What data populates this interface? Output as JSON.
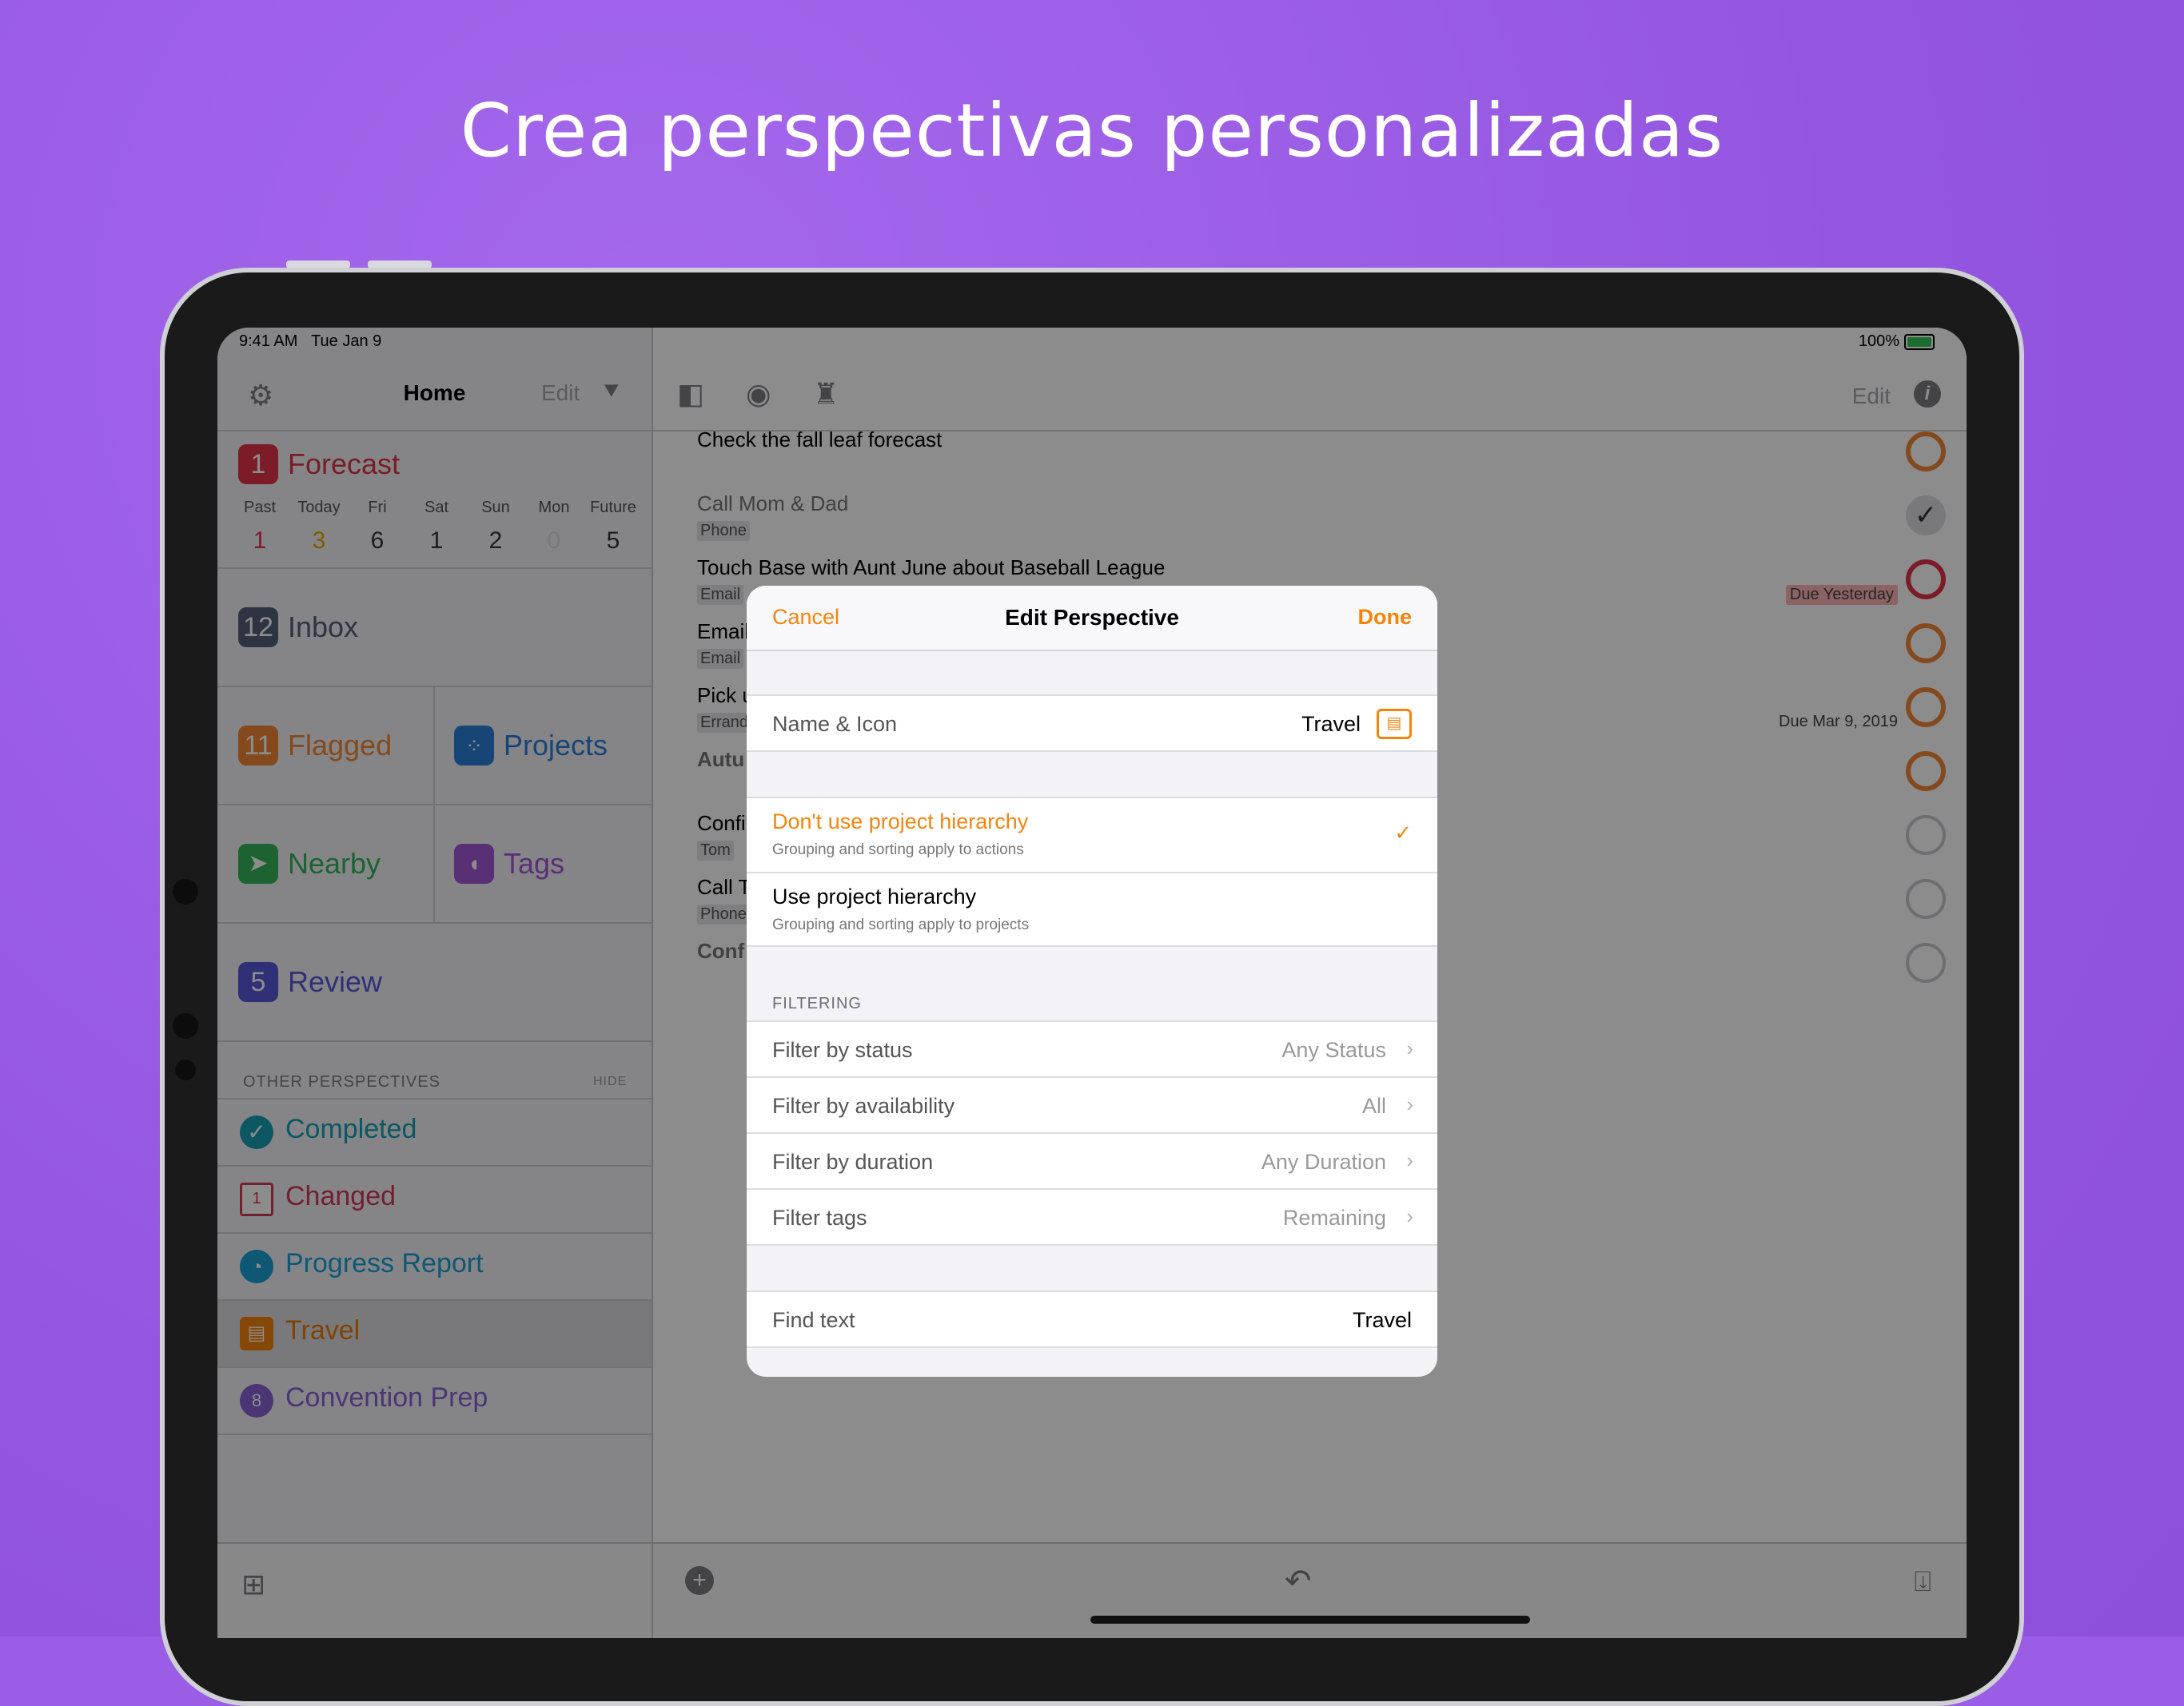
{
  "headline": "Crea perspectivas personalizadas",
  "status": {
    "time": "9:41 AM",
    "date": "Tue Jan 9",
    "battery": "100%"
  },
  "sidebar": {
    "title": "Home",
    "edit_label": "Edit",
    "forecast": {
      "label": "Forecast",
      "badge": "1",
      "days": [
        "Past",
        "Today",
        "Fri",
        "Sat",
        "Sun",
        "Mon",
        "Future"
      ],
      "counts": [
        "1",
        "3",
        "6",
        "1",
        "2",
        "0",
        "5"
      ]
    },
    "inbox": {
      "label": "Inbox",
      "badge": "12"
    },
    "flagged": {
      "label": "Flagged",
      "badge": "11"
    },
    "projects": {
      "label": "Projects"
    },
    "nearby": {
      "label": "Nearby"
    },
    "tags": {
      "label": "Tags"
    },
    "review": {
      "label": "Review",
      "badge": "5"
    },
    "other_header": "OTHER PERSPECTIVES",
    "hide_label": "HIDE",
    "perspectives": [
      {
        "label": "Completed"
      },
      {
        "label": "Changed"
      },
      {
        "label": "Progress Report"
      },
      {
        "label": "Travel"
      },
      {
        "label": "Convention Prep"
      }
    ]
  },
  "main": {
    "edit_label": "Edit",
    "tasks": [
      {
        "title": "Check the fall leaf forecast"
      },
      {
        "title": "Call Mom & Dad",
        "tag": "Phone"
      },
      {
        "title": "Touch Base with Aunt June about Baseball League",
        "tag": "Email",
        "due": "Due Yesterday"
      },
      {
        "title": "Email",
        "tag": "Email"
      },
      {
        "title": "Pick u",
        "tag": "Errand",
        "due": "Due Mar 9, 2019"
      },
      {
        "title": "Autu"
      },
      {
        "title": "Confi",
        "tag": "Tom"
      },
      {
        "title": "Call T",
        "tag": "Phone"
      },
      {
        "title": "Conf"
      }
    ]
  },
  "modal": {
    "cancel": "Cancel",
    "title": "Edit Perspective",
    "done": "Done",
    "name_icon_label": "Name & Icon",
    "name_value": "Travel",
    "hierarchy_off_label": "Don't use project hierarchy",
    "hierarchy_off_sub": "Grouping and sorting apply to actions",
    "hierarchy_on_label": "Use project hierarchy",
    "hierarchy_on_sub": "Grouping and sorting apply to projects",
    "filtering_header": "FILTERING",
    "filters": [
      {
        "label": "Filter by status",
        "value": "Any Status"
      },
      {
        "label": "Filter by availability",
        "value": "All"
      },
      {
        "label": "Filter by duration",
        "value": "Any Duration"
      },
      {
        "label": "Filter tags",
        "value": "Remaining"
      }
    ],
    "find_label": "Find text",
    "find_value": "Travel"
  },
  "colors": {
    "accent": "#f5840c",
    "forecast": "#e0344a",
    "inbox": "#566079",
    "flagged": "#f08535",
    "projects": "#2a7ed8",
    "nearby": "#33b45a",
    "tags": "#a257d6",
    "review": "#5758d6"
  }
}
